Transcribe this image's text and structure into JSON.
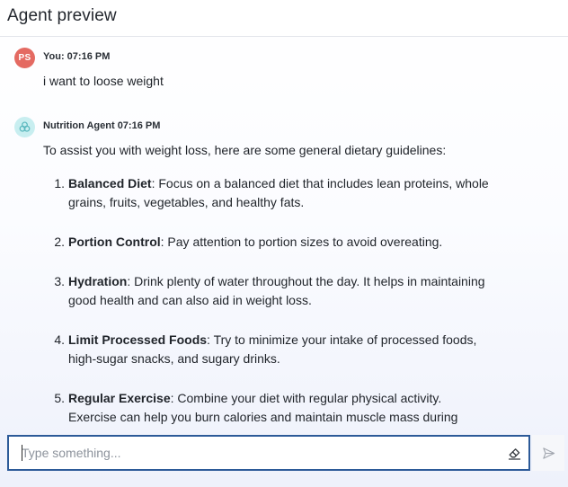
{
  "header": {
    "title": "Agent preview"
  },
  "messages": {
    "user": {
      "avatar_initials": "PS",
      "avatar_color": "#e46a62",
      "meta": "You: 07:16 PM",
      "text": "i want to loose weight"
    },
    "agent": {
      "avatar_icon": "agent-logo-icon",
      "avatar_color": "#c8eef0",
      "meta": "Nutrition Agent 07:16 PM",
      "intro": "To assist you with weight loss, here are some general dietary guidelines:",
      "guidelines": [
        {
          "number": "1.",
          "title": "Balanced Diet",
          "body": ": Focus on a balanced diet that includes lean proteins, whole grains, fruits, vegetables, and healthy fats."
        },
        {
          "number": "2.",
          "title": "Portion Control",
          "body": ": Pay attention to portion sizes to avoid overeating."
        },
        {
          "number": "3.",
          "title": "Hydration",
          "body": ": Drink plenty of water throughout the day. It helps in maintaining good health and can also aid in weight loss."
        },
        {
          "number": "4.",
          "title": "Limit Processed Foods",
          "body": ": Try to minimize your intake of processed foods, high-sugar snacks, and sugary drinks."
        },
        {
          "number": "5.",
          "title": "Regular Exercise",
          "body": ": Combine your diet with regular physical activity. Exercise can help you burn calories and maintain muscle mass during weight loss."
        }
      ]
    }
  },
  "composer": {
    "value": "",
    "placeholder": "Type something...",
    "clear_icon": "eraser-icon",
    "send_icon": "send-icon",
    "accent_color": "#2c5a98"
  }
}
